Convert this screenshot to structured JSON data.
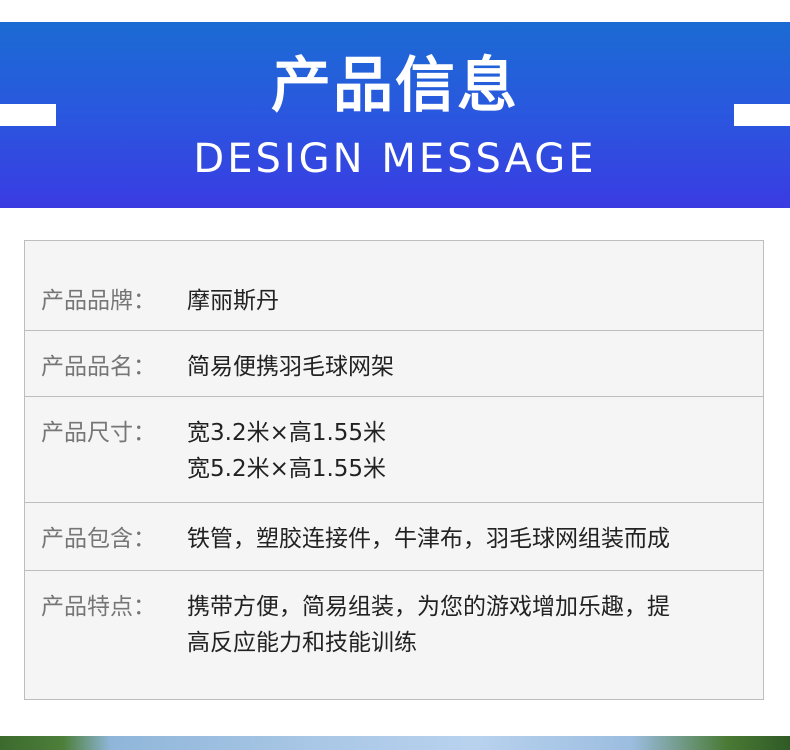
{
  "header": {
    "title": "产品信息",
    "subtitle": "DESIGN MESSAGE"
  },
  "info": {
    "rows": [
      {
        "label": "产品品牌：",
        "value_lines": [
          "摩丽斯丹"
        ]
      },
      {
        "label": "产品品名：",
        "value_lines": [
          "简易便携羽毛球网架"
        ]
      },
      {
        "label": "产品尺寸：",
        "value_lines": [
          "宽3.2米×高1.55米",
          "宽5.2米×高1.55米"
        ]
      },
      {
        "label": "产品包含：",
        "value_lines": [
          "铁管，塑胶连接件，牛津布，羽毛球网组装而成"
        ]
      },
      {
        "label": "产品特点：",
        "value_lines": [
          "携带方便，简易组装，为您的游戏增加乐趣，提",
          "高反应能力和技能训练"
        ]
      }
    ]
  },
  "colors": {
    "banner_top": "#1b6bd3",
    "banner_bottom": "#3a3be2",
    "label_text": "#767676",
    "value_text": "#222222",
    "table_bg": "#f5f5f5",
    "table_border": "#bdbdbd"
  }
}
